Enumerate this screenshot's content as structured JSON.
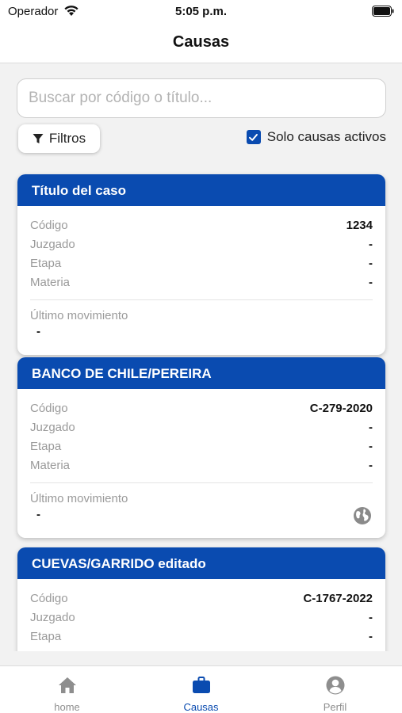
{
  "status_bar": {
    "carrier": "Operador",
    "time": "5:05 p.m."
  },
  "header": {
    "title": "Causas"
  },
  "search": {
    "placeholder": "Buscar por código o título...",
    "value": ""
  },
  "filters": {
    "button_label": "Filtros",
    "icon": "filter-icon"
  },
  "active_only": {
    "label": "Solo causas activos",
    "checked": true
  },
  "field_labels": {
    "codigo": "Código",
    "juzgado": "Juzgado",
    "etapa": "Etapa",
    "materia": "Materia",
    "ultimo_movimiento": "Último movimiento"
  },
  "cases": [
    {
      "title": "Título del caso",
      "codigo": "1234",
      "juzgado": "-",
      "etapa": "-",
      "materia": "-",
      "ultimo_movimiento": "-",
      "has_globe_icon": false
    },
    {
      "title": "BANCO DE CHILE/PEREIRA",
      "codigo": "C-279-2020",
      "juzgado": "-",
      "etapa": "-",
      "materia": "-",
      "ultimo_movimiento": "-",
      "has_globe_icon": true
    },
    {
      "title": "CUEVAS/GARRIDO editado",
      "codigo": "C-1767-2022",
      "juzgado": "-",
      "etapa": "-"
    }
  ],
  "tabs": [
    {
      "label": "home",
      "icon": "home-icon",
      "active": false
    },
    {
      "label": "Causas",
      "icon": "briefcase-icon",
      "active": true
    },
    {
      "label": "Perfil",
      "icon": "account-circle-icon",
      "active": false
    }
  ],
  "colors": {
    "primary": "#0a4bb0",
    "background": "#f2f2f2",
    "label_gray": "#9a9a9a",
    "tab_inactive": "#8e8e8e"
  }
}
